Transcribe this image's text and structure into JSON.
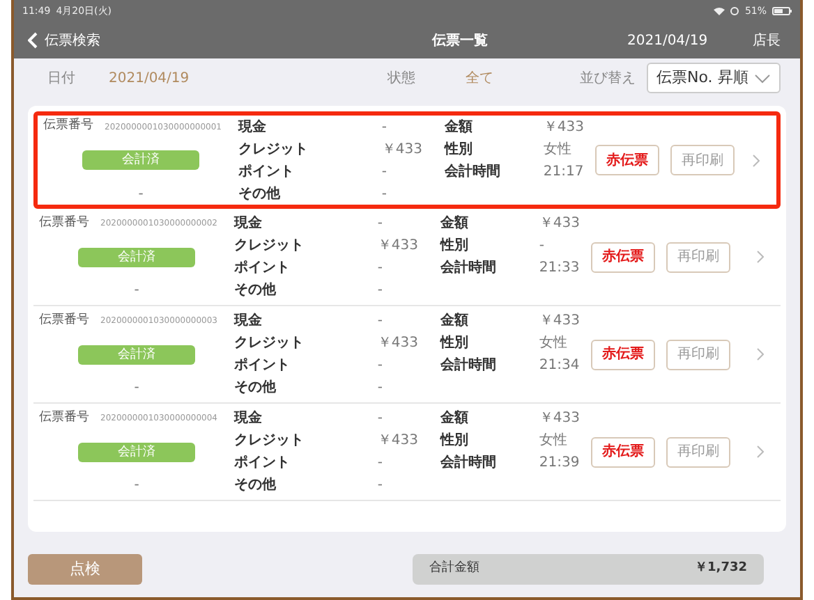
{
  "status_bar": {
    "time": "11:49",
    "date": "4月20日(火)",
    "battery": "51%"
  },
  "nav": {
    "back": "伝票検索",
    "title": "伝票一覧",
    "date": "2021/04/19",
    "user": "店長"
  },
  "filters": {
    "date_label": "日付",
    "date": "2021/04/19",
    "state_label": "状態",
    "state": "全て",
    "sort_label": "並び替え",
    "sort": "伝票No. 昇順"
  },
  "rows": [
    {
      "highlighted": true,
      "number_label": "伝票番号",
      "number": "2020000001030000000001",
      "status": "会計済",
      "note": "-",
      "payments": [
        {
          "label": "現金",
          "value": "-"
        },
        {
          "label": "クレジット",
          "value": "￥433"
        },
        {
          "label": "ポイント",
          "value": "-"
        },
        {
          "label": "その他",
          "value": "-"
        }
      ],
      "details": [
        {
          "label": "金額",
          "value": "￥433"
        },
        {
          "label": "性別",
          "value": "女性"
        },
        {
          "label": "会計時間",
          "value": "21:17"
        }
      ],
      "void_button": "赤伝票",
      "reprint_button": "再印刷"
    },
    {
      "highlighted": false,
      "number_label": "伝票番号",
      "number": "2020000001030000000002",
      "status": "会計済",
      "note": "-",
      "payments": [
        {
          "label": "現金",
          "value": "-"
        },
        {
          "label": "クレジット",
          "value": "￥433"
        },
        {
          "label": "ポイント",
          "value": "-"
        },
        {
          "label": "その他",
          "value": "-"
        }
      ],
      "details": [
        {
          "label": "金額",
          "value": "￥433"
        },
        {
          "label": "性別",
          "value": "-"
        },
        {
          "label": "会計時間",
          "value": "21:33"
        }
      ],
      "void_button": "赤伝票",
      "reprint_button": "再印刷"
    },
    {
      "highlighted": false,
      "number_label": "伝票番号",
      "number": "2020000001030000000003",
      "status": "会計済",
      "note": "-",
      "payments": [
        {
          "label": "現金",
          "value": "-"
        },
        {
          "label": "クレジット",
          "value": "￥433"
        },
        {
          "label": "ポイント",
          "value": "-"
        },
        {
          "label": "その他",
          "value": "-"
        }
      ],
      "details": [
        {
          "label": "金額",
          "value": "￥433"
        },
        {
          "label": "性別",
          "value": "女性"
        },
        {
          "label": "会計時間",
          "value": "21:34"
        }
      ],
      "void_button": "赤伝票",
      "reprint_button": "再印刷"
    },
    {
      "highlighted": false,
      "number_label": "伝票番号",
      "number": "2020000001030000000004",
      "status": "会計済",
      "note": "-",
      "payments": [
        {
          "label": "現金",
          "value": "-"
        },
        {
          "label": "クレジット",
          "value": "￥433"
        },
        {
          "label": "ポイント",
          "value": "-"
        },
        {
          "label": "その他",
          "value": "-"
        }
      ],
      "details": [
        {
          "label": "金額",
          "value": "￥433"
        },
        {
          "label": "性別",
          "value": "女性"
        },
        {
          "label": "会計時間",
          "value": "21:39"
        }
      ],
      "void_button": "赤伝票",
      "reprint_button": "再印刷"
    }
  ],
  "footer": {
    "check_button": "点検",
    "total_label": "合計金額",
    "total": "￥1,732"
  }
}
